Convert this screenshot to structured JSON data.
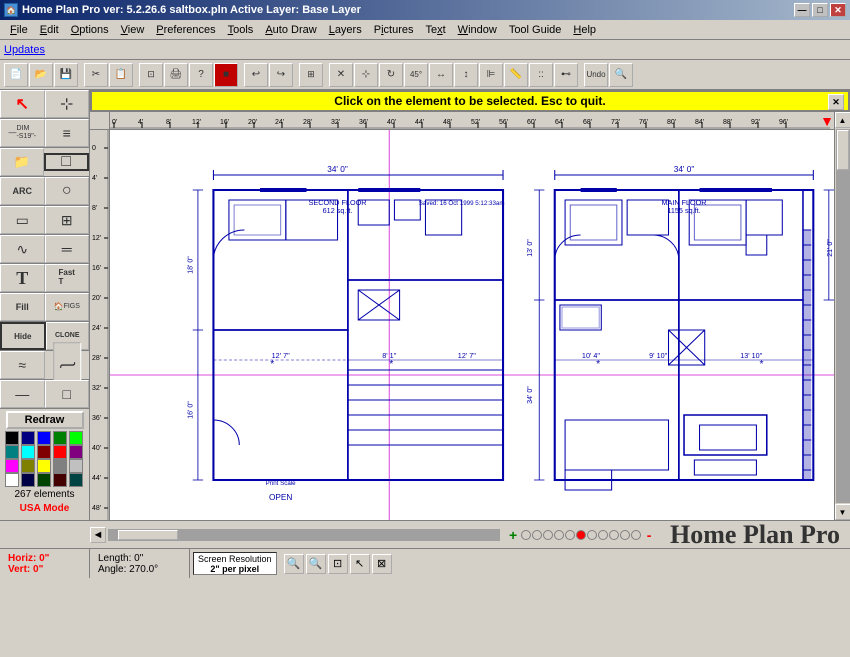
{
  "titleBar": {
    "icon": "🏠",
    "title": "Home Plan Pro ver: 5.2.26.6    saltbox.pln      Active Layer: Base Layer",
    "minimizeBtn": "—",
    "maximizeBtn": "□",
    "closeBtn": "✕"
  },
  "menuBar": {
    "items": [
      {
        "label": "File",
        "id": "file"
      },
      {
        "label": "Edit",
        "id": "edit"
      },
      {
        "label": "Options",
        "id": "options"
      },
      {
        "label": "View",
        "id": "view"
      },
      {
        "label": "Preferences",
        "id": "preferences"
      },
      {
        "label": "Tools",
        "id": "tools"
      },
      {
        "label": "Auto Draw",
        "id": "autodraw"
      },
      {
        "label": "Layers",
        "id": "layers"
      },
      {
        "label": "Pictures",
        "id": "pictures"
      },
      {
        "label": "Text",
        "id": "text"
      },
      {
        "label": "Window",
        "id": "window"
      },
      {
        "label": "Tool Guide",
        "id": "toolguide"
      },
      {
        "label": "Help",
        "id": "help"
      }
    ]
  },
  "updatesBar": {
    "linkText": "Updates"
  },
  "notification": {
    "text": "Click on the element to be selected.  Esc to quit."
  },
  "toolbox": {
    "tools": [
      [
        {
          "icon": "↖",
          "label": ""
        },
        {
          "icon": "⊹",
          "label": ""
        }
      ],
      [
        {
          "icon": "—",
          "label": "DIM\n-S19\"-"
        },
        {
          "icon": "≡",
          "label": ""
        }
      ],
      [
        {
          "icon": "📁",
          "label": ""
        },
        {
          "icon": "□",
          "label": ""
        }
      ],
      [
        {
          "icon": "ARC",
          "label": ""
        },
        {
          "icon": "○",
          "label": ""
        }
      ],
      [
        {
          "icon": "▭",
          "label": ""
        },
        {
          "icon": "⊞",
          "label": ""
        }
      ],
      [
        {
          "icon": "∿",
          "label": ""
        },
        {
          "icon": "═",
          "label": ""
        }
      ],
      [
        {
          "icon": "T",
          "label": ""
        },
        {
          "icon": "Fast\nT",
          "label": ""
        }
      ],
      [
        {
          "icon": "Fill",
          "label": ""
        },
        {
          "icon": "🏠",
          "label": "FIGS"
        }
      ],
      [
        {
          "icon": "Hide",
          "label": ""
        },
        {
          "icon": "CLONE",
          "label": ""
        }
      ],
      [
        {
          "icon": "≈",
          "label": ""
        },
        {
          "icon": "∫",
          "label": ""
        }
      ],
      [
        {
          "icon": "—",
          "label": ""
        },
        {
          "icon": "□",
          "label": ""
        }
      ]
    ],
    "redrawBtn": "Redraw",
    "elementsCount": "267 elements",
    "usaMode": "USA Mode"
  },
  "hRuler": {
    "ticks": [
      "0'",
      "4'",
      "8'",
      "12'",
      "16'",
      "20'",
      "24'",
      "28'",
      "32'",
      "36'",
      "40'",
      "44'",
      "48'",
      "52'",
      "56'",
      "60'",
      "64'",
      "68'",
      "72'",
      "76'",
      "80'",
      "84'",
      "88'",
      "92'",
      "96'"
    ]
  },
  "statusBar": {
    "horiz": "Horiz: 0\"",
    "vert": "Vert: 0\"",
    "length": "Length: 0\"",
    "angle": "Angle: 270.0°",
    "resolution": "Screen Resolution",
    "resolutionValue": "2\" per pixel"
  },
  "branding": {
    "text": "Home Plan Pro"
  },
  "navControls": {
    "addBtn": "+",
    "removeBtn": "-",
    "dots": [
      false,
      false,
      false,
      false,
      false,
      true,
      false,
      false,
      false,
      false,
      false
    ]
  },
  "zoomBtns": [
    "🔍+",
    "🔍-",
    "⊡",
    "↖",
    "⊠"
  ],
  "colors": {
    "swatches": [
      "#000000",
      "#000080",
      "#0000ff",
      "#008000",
      "#00ff00",
      "#008080",
      "#00ffff",
      "#800000",
      "#ff0000",
      "#800080",
      "#ff00ff",
      "#808000",
      "#ffff00",
      "#808080",
      "#c0c0c0",
      "#ffffff",
      "#000033",
      "#003300",
      "#330000",
      "#003333"
    ]
  }
}
